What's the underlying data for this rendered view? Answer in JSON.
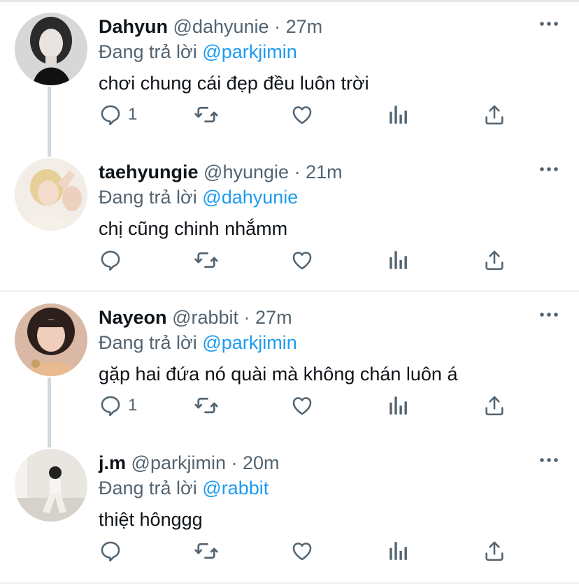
{
  "tweets": [
    {
      "name": "Dahyun",
      "handle": "@dahyunie",
      "time": "27m",
      "reply_prefix": "Đang trả lời",
      "reply_to": "@parkjimin",
      "text": "chơi chung cái đẹp đều luôn trời",
      "reply_count": "1"
    },
    {
      "name": "taehyungie",
      "handle": "@hyungie",
      "time": "21m",
      "reply_prefix": "Đang trả lời",
      "reply_to": "@dahyunie",
      "text": "chị cũng chinh nhắmm",
      "reply_count": ""
    },
    {
      "name": "Nayeon",
      "handle": "@rabbit",
      "time": "27m",
      "reply_prefix": "Đang trả lời",
      "reply_to": "@parkjimin",
      "text": "gặp hai đứa nó quài mà không chán luôn á",
      "reply_count": "1"
    },
    {
      "name": "j.m",
      "handle": "@parkjimin",
      "time": "20m",
      "reply_prefix": "Đang trả lời",
      "reply_to": "@rabbit",
      "text": "thiệt hônggg",
      "reply_count": ""
    }
  ],
  "dot": "·",
  "icons": [
    "more-icon",
    "reply-icon",
    "retweet-icon",
    "like-icon",
    "analytics-icon",
    "share-icon"
  ],
  "colors": {
    "accent": "#1d9bf0",
    "secondary_text": "#536471",
    "primary_text": "#0f1419",
    "thread_line": "#cfd9de"
  }
}
